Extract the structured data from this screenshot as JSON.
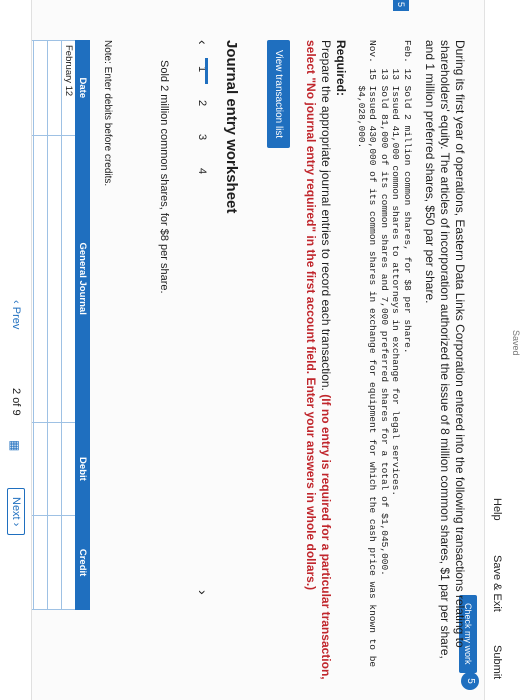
{
  "header": {
    "saved": "Saved",
    "help": "Help",
    "save_exit": "Save & Exit",
    "submit": "Submit"
  },
  "check_my_work": "Check my work",
  "badge_count": "5",
  "side_tab": "5",
  "problem": {
    "intro": "During its first year of operations, Eastern Data Links Corporation entered into the following transactions relating to shareholders' equity. The articles of incorporation authorized the issue of 8 million common shares, $1 par per share, and 1 million preferred shares, $50 par per share.",
    "transactions": [
      "Feb. 12 Sold 2 million common shares, for $8 per share.",
      "     13 Issued 41,000 common shares to attorneys in exchange for legal services.",
      "     13 Sold 81,000 of its common shares and 7,000 preferred shares for a total of $1,045,000.",
      "Nov. 15 Issued 430,000 of its common shares in exchange for equipment for which the cash price was known to be",
      "        $4,028,000."
    ],
    "required_heading": "Required:",
    "required_text": "Prepare the appropriate journal entries to record each transaction.",
    "required_red": "(If no entry is required for a particular transaction, select \"No journal entry required\" in the first account field. Enter your answers in whole dollars.)"
  },
  "view_transaction_list": "View transaction list",
  "worksheet": {
    "title": "Journal entry worksheet",
    "pages": [
      "1",
      "2",
      "3",
      "4"
    ],
    "description": "Sold 2 million common shares, for $8 per share.",
    "note": "Note: Enter debits before credits.",
    "columns": [
      "Date",
      "General Journal",
      "Debit",
      "Credit"
    ],
    "rows": [
      {
        "date": "February 12",
        "account": "",
        "debit": "",
        "credit": ""
      },
      {
        "date": "",
        "account": "",
        "debit": "",
        "credit": ""
      },
      {
        "date": "",
        "account": "",
        "debit": "",
        "credit": ""
      },
      {
        "date": "",
        "account": "",
        "debit": "",
        "credit": ""
      },
      {
        "date": "",
        "account": "",
        "debit": "",
        "credit": ""
      }
    ]
  },
  "footer": {
    "prev": "Prev",
    "page_current": "2",
    "page_of": "of",
    "page_total": "9",
    "next": "Next"
  }
}
